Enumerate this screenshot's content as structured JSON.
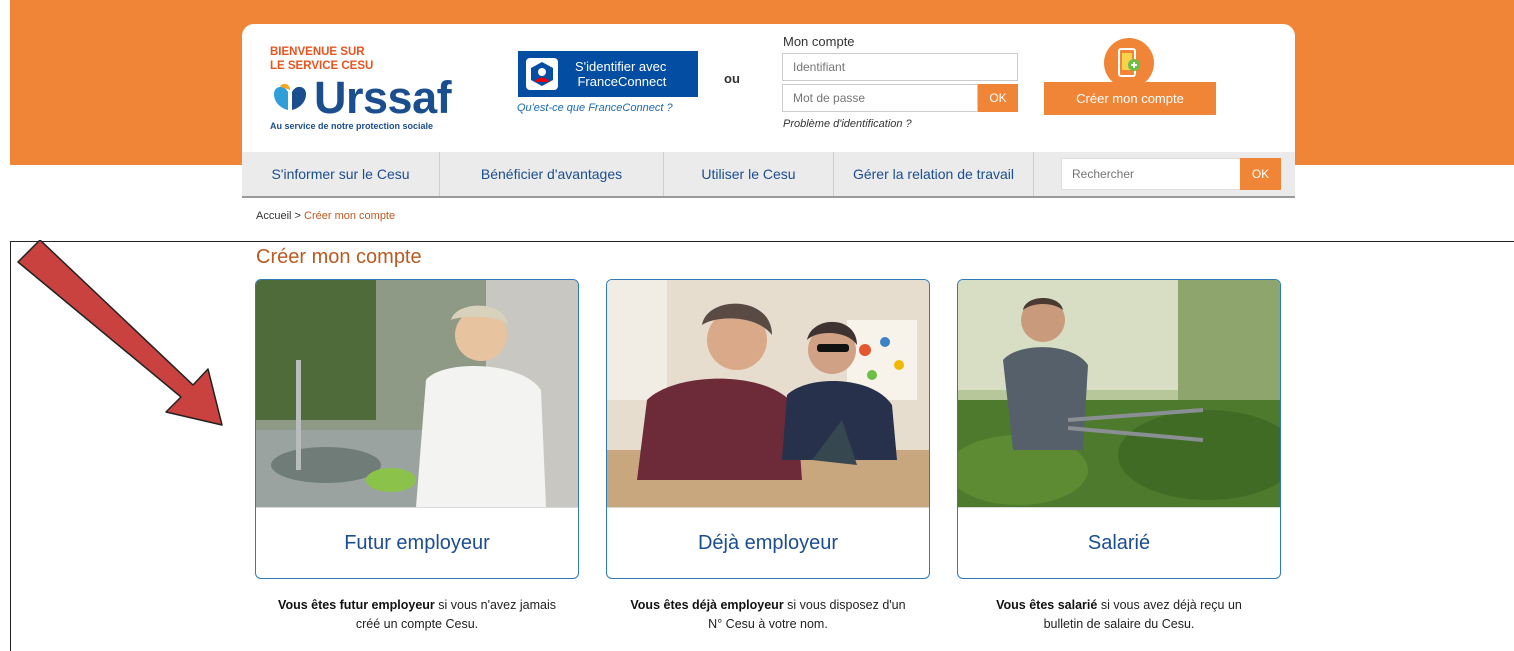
{
  "header": {
    "welcome_line1": "BIENVENUE SUR",
    "welcome_line2": "LE SERVICE CESU",
    "logo_text": "Urssaf",
    "tagline": "Au service de notre protection sociale",
    "franceconnect_line1": "S'identifier avec",
    "franceconnect_line2": "FranceConnect",
    "franceconnect_link": "Qu'est-ce que FranceConnect ?",
    "or_label": "ou",
    "account_label": "Mon compte",
    "identifier_placeholder": "Identifiant",
    "password_placeholder": "Mot de passe",
    "ok_label": "OK",
    "problem_link": "Problème d'identification ?",
    "create_account_button": "Créer mon compte"
  },
  "nav": {
    "items": [
      {
        "label": "S'informer sur le Cesu"
      },
      {
        "label": "Bénéficier d'avantages"
      },
      {
        "label": "Utiliser le Cesu"
      },
      {
        "label": "Gérer la relation de travail"
      }
    ],
    "search_placeholder": "Rechercher",
    "search_ok": "OK"
  },
  "breadcrumb": {
    "home": "Accueil",
    "separator": " > ",
    "current": "Créer mon compte"
  },
  "page_title": "Créer mon compte",
  "cards": [
    {
      "label": "Futur employeur",
      "desc_bold": "Vous êtes futur employeur",
      "desc_rest": " si vous n'avez jamais",
      "desc_line2": "créé un compte Cesu."
    },
    {
      "label": "Déjà employeur",
      "desc_bold": "Vous êtes déjà employeur",
      "desc_rest": " si vous disposez d'un",
      "desc_line2": "N° Cesu à votre nom."
    },
    {
      "label": "Salarié",
      "desc_bold": "Vous êtes salarié",
      "desc_rest": " si vous avez déjà reçu un",
      "desc_line2": "bulletin de salaire du Cesu."
    }
  ],
  "colors": {
    "brand_orange": "#F08537",
    "urssaf_blue": "#1B4E8F",
    "franceconnect_blue": "#034EA2",
    "title_brown": "#B85A21",
    "annotation_arrow": "#C9423F"
  }
}
